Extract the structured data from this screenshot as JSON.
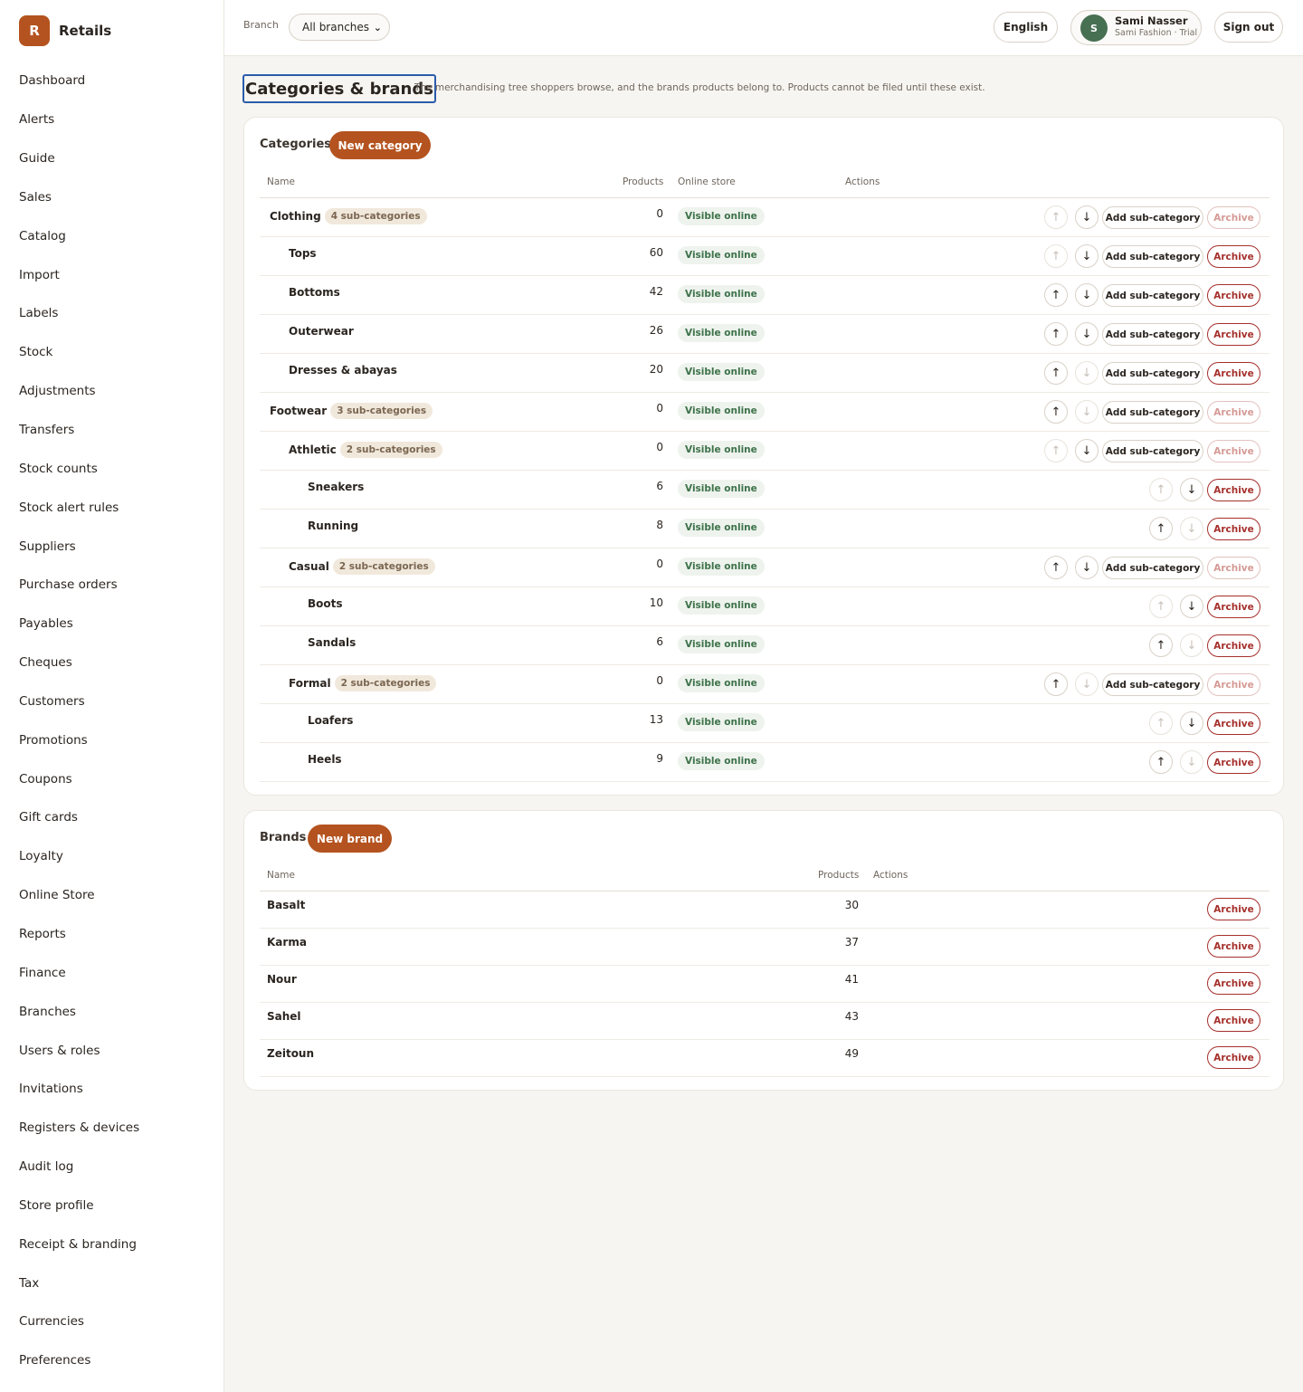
{
  "app": {
    "logo_letter": "R",
    "name": "Retails"
  },
  "nav": [
    "Dashboard",
    "Alerts",
    "Guide",
    "Sales",
    "Catalog",
    "Import",
    "Labels",
    "Stock",
    "Adjustments",
    "Transfers",
    "Stock counts",
    "Stock alert rules",
    "Suppliers",
    "Purchase orders",
    "Payables",
    "Cheques",
    "Customers",
    "Promotions",
    "Coupons",
    "Gift cards",
    "Loyalty",
    "Online Store",
    "Reports",
    "Finance",
    "Branches",
    "Users & roles",
    "Invitations",
    "Registers & devices",
    "Audit log",
    "Store profile",
    "Receipt & branding",
    "Tax",
    "Currencies",
    "Preferences"
  ],
  "topbar": {
    "branch_label": "Branch",
    "branch_value": "All branches",
    "language": "English",
    "user": {
      "initial": "S",
      "name": "Sami Nasser",
      "subtitle": "Sami Fashion · Trial"
    },
    "signout": "Sign out"
  },
  "page": {
    "title": "Categories & brands",
    "description": "The merchandising tree shoppers browse, and the brands products belong to. Products cannot be filed until these exist."
  },
  "categories": {
    "title": "Categories",
    "new_button": "New category",
    "columns": {
      "name": "Name",
      "products": "Products",
      "online": "Online store",
      "actions": "Actions"
    },
    "visible_label": "Visible online",
    "add_sub_label": "Add sub-category",
    "archive_label": "Archive",
    "rows": [
      {
        "name": "Clothing",
        "level": 0,
        "badge": "4 sub-categories",
        "products": "0",
        "up_enabled": false,
        "down_enabled": true,
        "add_sub": true,
        "archive_enabled": false
      },
      {
        "name": "Tops",
        "level": 1,
        "badge": "",
        "products": "60",
        "up_enabled": false,
        "down_enabled": true,
        "add_sub": true,
        "archive_enabled": true
      },
      {
        "name": "Bottoms",
        "level": 1,
        "badge": "",
        "products": "42",
        "up_enabled": true,
        "down_enabled": true,
        "add_sub": true,
        "archive_enabled": true
      },
      {
        "name": "Outerwear",
        "level": 1,
        "badge": "",
        "products": "26",
        "up_enabled": true,
        "down_enabled": true,
        "add_sub": true,
        "archive_enabled": true
      },
      {
        "name": "Dresses & abayas",
        "level": 1,
        "badge": "",
        "products": "20",
        "up_enabled": true,
        "down_enabled": false,
        "add_sub": true,
        "archive_enabled": true
      },
      {
        "name": "Footwear",
        "level": 0,
        "badge": "3 sub-categories",
        "products": "0",
        "up_enabled": true,
        "down_enabled": false,
        "add_sub": true,
        "archive_enabled": false
      },
      {
        "name": "Athletic",
        "level": 1,
        "badge": "2 sub-categories",
        "products": "0",
        "up_enabled": false,
        "down_enabled": true,
        "add_sub": true,
        "archive_enabled": false
      },
      {
        "name": "Sneakers",
        "level": 2,
        "badge": "",
        "products": "6",
        "up_enabled": false,
        "down_enabled": true,
        "add_sub": false,
        "archive_enabled": true
      },
      {
        "name": "Running",
        "level": 2,
        "badge": "",
        "products": "8",
        "up_enabled": true,
        "down_enabled": false,
        "add_sub": false,
        "archive_enabled": true
      },
      {
        "name": "Casual",
        "level": 1,
        "badge": "2 sub-categories",
        "products": "0",
        "up_enabled": true,
        "down_enabled": true,
        "add_sub": true,
        "archive_enabled": false
      },
      {
        "name": "Boots",
        "level": 2,
        "badge": "",
        "products": "10",
        "up_enabled": false,
        "down_enabled": true,
        "add_sub": false,
        "archive_enabled": true
      },
      {
        "name": "Sandals",
        "level": 2,
        "badge": "",
        "products": "6",
        "up_enabled": true,
        "down_enabled": false,
        "add_sub": false,
        "archive_enabled": true
      },
      {
        "name": "Formal",
        "level": 1,
        "badge": "2 sub-categories",
        "products": "0",
        "up_enabled": true,
        "down_enabled": false,
        "add_sub": true,
        "archive_enabled": false
      },
      {
        "name": "Loafers",
        "level": 2,
        "badge": "",
        "products": "13",
        "up_enabled": false,
        "down_enabled": true,
        "add_sub": false,
        "archive_enabled": true
      },
      {
        "name": "Heels",
        "level": 2,
        "badge": "",
        "products": "9",
        "up_enabled": true,
        "down_enabled": false,
        "add_sub": false,
        "archive_enabled": true
      }
    ]
  },
  "brands": {
    "title": "Brands",
    "new_button": "New brand",
    "columns": {
      "name": "Name",
      "products": "Products",
      "actions": "Actions"
    },
    "archive_label": "Archive",
    "rows": [
      {
        "name": "Basalt",
        "products": "30"
      },
      {
        "name": "Karma",
        "products": "37"
      },
      {
        "name": "Nour",
        "products": "41"
      },
      {
        "name": "Sahel",
        "products": "43"
      },
      {
        "name": "Zeitoun",
        "products": "49"
      }
    ]
  },
  "colors": {
    "accent": "#b4531f",
    "danger": "#a5302c",
    "success": "#3d7249",
    "avatar": "#476f52",
    "focus": "#2a5cab"
  },
  "icons": {
    "up": "arrow-up-icon",
    "down": "arrow-down-icon",
    "select": "chevron-down-icon"
  }
}
